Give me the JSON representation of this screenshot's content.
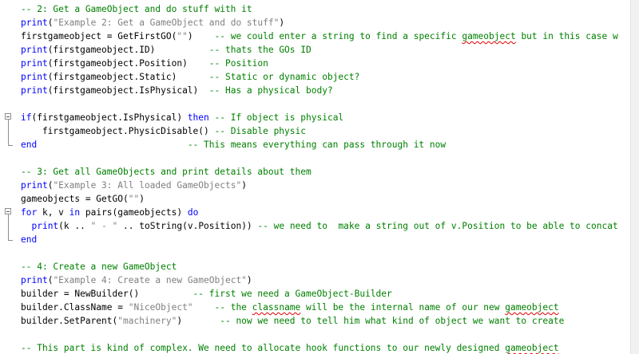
{
  "lines": [
    {
      "folding": "",
      "segments": [
        {
          "t": "cm",
          "v": "-- 2: Get a GameObject and do stuff with it"
        }
      ]
    },
    {
      "folding": "",
      "segments": [
        {
          "t": "fn",
          "v": "print"
        },
        {
          "t": "op",
          "v": "("
        },
        {
          "t": "str",
          "v": "\"Example 2: Get a GameObject and do stuff\""
        },
        {
          "t": "op",
          "v": ")"
        }
      ]
    },
    {
      "folding": "",
      "segments": [
        {
          "t": "id",
          "v": "firstgameobject = GetFirstGO("
        },
        {
          "t": "str",
          "v": "\"\""
        },
        {
          "t": "id",
          "v": ")    "
        },
        {
          "t": "cm",
          "v": "-- we could enter a string to find a specific "
        },
        {
          "t": "cm",
          "v": "gameobject",
          "squig": true
        },
        {
          "t": "cm",
          "v": " but in this case w"
        }
      ]
    },
    {
      "folding": "",
      "segments": [
        {
          "t": "fn",
          "v": "print"
        },
        {
          "t": "id",
          "v": "(firstgameobject.ID)          "
        },
        {
          "t": "cm",
          "v": "-- thats the GOs ID"
        }
      ]
    },
    {
      "folding": "",
      "segments": [
        {
          "t": "fn",
          "v": "print"
        },
        {
          "t": "id",
          "v": "(firstgameobject.Position)    "
        },
        {
          "t": "cm",
          "v": "-- Position"
        }
      ]
    },
    {
      "folding": "",
      "segments": [
        {
          "t": "fn",
          "v": "print"
        },
        {
          "t": "id",
          "v": "(firstgameobject.Static)      "
        },
        {
          "t": "cm",
          "v": "-- Static or dynamic object?"
        }
      ]
    },
    {
      "folding": "",
      "segments": [
        {
          "t": "fn",
          "v": "print"
        },
        {
          "t": "id",
          "v": "(firstgameobject.IsPhysical)  "
        },
        {
          "t": "cm",
          "v": "-- Has a physical body?"
        }
      ]
    },
    {
      "folding": "",
      "segments": []
    },
    {
      "folding": "start",
      "segments": [
        {
          "t": "kw",
          "v": "if"
        },
        {
          "t": "id",
          "v": "(firstgameobject.IsPhysical) "
        },
        {
          "t": "kw",
          "v": "then"
        },
        {
          "t": "id",
          "v": " "
        },
        {
          "t": "cm",
          "v": "-- If object is physical"
        }
      ]
    },
    {
      "folding": "mid",
      "segments": [
        {
          "t": "id",
          "v": "    firstgameobject.PhysicDisable() "
        },
        {
          "t": "cm",
          "v": "-- Disable physic"
        }
      ]
    },
    {
      "folding": "end",
      "segments": [
        {
          "t": "kw",
          "v": "end"
        },
        {
          "t": "id",
          "v": "                            "
        },
        {
          "t": "cm",
          "v": "-- This means everything can pass through it now"
        }
      ]
    },
    {
      "folding": "",
      "segments": []
    },
    {
      "folding": "",
      "segments": [
        {
          "t": "cm",
          "v": "-- 3: Get all GameObjects and print details about them"
        }
      ]
    },
    {
      "folding": "",
      "segments": [
        {
          "t": "fn",
          "v": "print"
        },
        {
          "t": "op",
          "v": "("
        },
        {
          "t": "str",
          "v": "\"Example 3: All loaded GameObjects\""
        },
        {
          "t": "op",
          "v": ")"
        }
      ]
    },
    {
      "folding": "",
      "segments": [
        {
          "t": "id",
          "v": "gameobjects = GetGO("
        },
        {
          "t": "str",
          "v": "\"\""
        },
        {
          "t": "id",
          "v": ")"
        }
      ]
    },
    {
      "folding": "start",
      "segments": [
        {
          "t": "kw",
          "v": "for"
        },
        {
          "t": "id",
          "v": " k, v "
        },
        {
          "t": "kw",
          "v": "in"
        },
        {
          "t": "id",
          "v": " pairs(gameobjects) "
        },
        {
          "t": "kw",
          "v": "do"
        }
      ]
    },
    {
      "folding": "mid",
      "segments": [
        {
          "t": "id",
          "v": "  "
        },
        {
          "t": "fn",
          "v": "print"
        },
        {
          "t": "id",
          "v": "(k .. "
        },
        {
          "t": "str",
          "v": "\" - \""
        },
        {
          "t": "id",
          "v": " .. toString(v.Position)) "
        },
        {
          "t": "cm",
          "v": "-- we need to  make a string out of v.Position to be able to concat"
        }
      ]
    },
    {
      "folding": "end",
      "segments": [
        {
          "t": "kw",
          "v": "end"
        }
      ]
    },
    {
      "folding": "",
      "segments": []
    },
    {
      "folding": "",
      "segments": [
        {
          "t": "cm",
          "v": "-- 4: Create a new GameObject"
        }
      ]
    },
    {
      "folding": "",
      "segments": [
        {
          "t": "fn",
          "v": "print"
        },
        {
          "t": "op",
          "v": "("
        },
        {
          "t": "str",
          "v": "\"Example 4: Create a new GameObject\""
        },
        {
          "t": "op",
          "v": ")"
        }
      ]
    },
    {
      "folding": "",
      "segments": [
        {
          "t": "id",
          "v": "builder = NewBuilder()          "
        },
        {
          "t": "cm",
          "v": "-- first we need a GameObject-Builder"
        }
      ]
    },
    {
      "folding": "",
      "segments": [
        {
          "t": "id",
          "v": "builder.ClassName = "
        },
        {
          "t": "str",
          "v": "\"NiceObject\""
        },
        {
          "t": "id",
          "v": "    "
        },
        {
          "t": "cm",
          "v": "-- the "
        },
        {
          "t": "cm",
          "v": "classname",
          "squig": true
        },
        {
          "t": "cm",
          "v": " will be the internal name of our new "
        },
        {
          "t": "cm",
          "v": "gameobject",
          "squig": true
        }
      ]
    },
    {
      "folding": "",
      "segments": [
        {
          "t": "id",
          "v": "builder.SetParent("
        },
        {
          "t": "str",
          "v": "\"machinery\""
        },
        {
          "t": "id",
          "v": ")       "
        },
        {
          "t": "cm",
          "v": "-- now we need to tell him what kind of object we want to create"
        }
      ]
    },
    {
      "folding": "",
      "segments": []
    },
    {
      "folding": "",
      "segments": [
        {
          "t": "cm",
          "v": "-- This part is kind of complex. We need to allocate hook functions to our newly designed "
        },
        {
          "t": "cm",
          "v": "gameobject",
          "squig": true
        }
      ]
    }
  ]
}
